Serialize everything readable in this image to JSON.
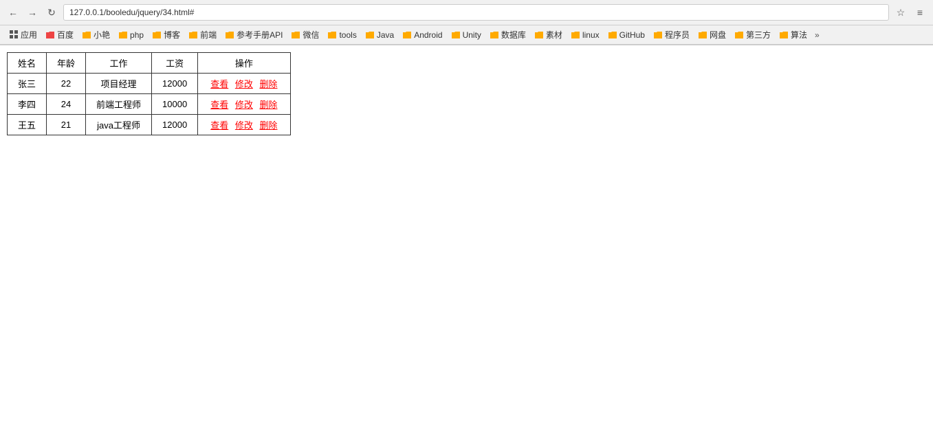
{
  "browser": {
    "address": "127.0.0.1/booledu/jquery/34.html#",
    "back_label": "←",
    "forward_label": "→",
    "reload_label": "↻",
    "star_label": "☆",
    "menu_label": "≡"
  },
  "bookmarks": [
    {
      "label": "应用",
      "icon": "grid"
    },
    {
      "label": "百度",
      "icon": "folder"
    },
    {
      "label": "小艳",
      "icon": "folder"
    },
    {
      "label": "php",
      "icon": "folder"
    },
    {
      "label": "博客",
      "icon": "folder"
    },
    {
      "label": "前端",
      "icon": "folder"
    },
    {
      "label": "参考手册API",
      "icon": "folder"
    },
    {
      "label": "微信",
      "icon": "folder"
    },
    {
      "label": "tools",
      "icon": "folder"
    },
    {
      "label": "Java",
      "icon": "folder"
    },
    {
      "label": "Android",
      "icon": "folder"
    },
    {
      "label": "Unity",
      "icon": "folder"
    },
    {
      "label": "数据库",
      "icon": "folder"
    },
    {
      "label": "素材",
      "icon": "folder"
    },
    {
      "label": "linux",
      "icon": "folder"
    },
    {
      "label": "GitHub",
      "icon": "folder"
    },
    {
      "label": "程序员",
      "icon": "folder"
    },
    {
      "label": "网盘",
      "icon": "folder"
    },
    {
      "label": "第三方",
      "icon": "folder"
    },
    {
      "label": "算法",
      "icon": "folder"
    }
  ],
  "table": {
    "headers": [
      "姓名",
      "年龄",
      "工作",
      "工资",
      "操作"
    ],
    "rows": [
      {
        "name": "张三",
        "age": "22",
        "job": "项目经理",
        "salary": "12000"
      },
      {
        "name": "李四",
        "age": "24",
        "job": "前端工程师",
        "salary": "10000"
      },
      {
        "name": "王五",
        "age": "21",
        "job": "java工程师",
        "salary": "12000"
      }
    ],
    "actions": [
      "查看",
      "修改",
      "删除"
    ]
  }
}
